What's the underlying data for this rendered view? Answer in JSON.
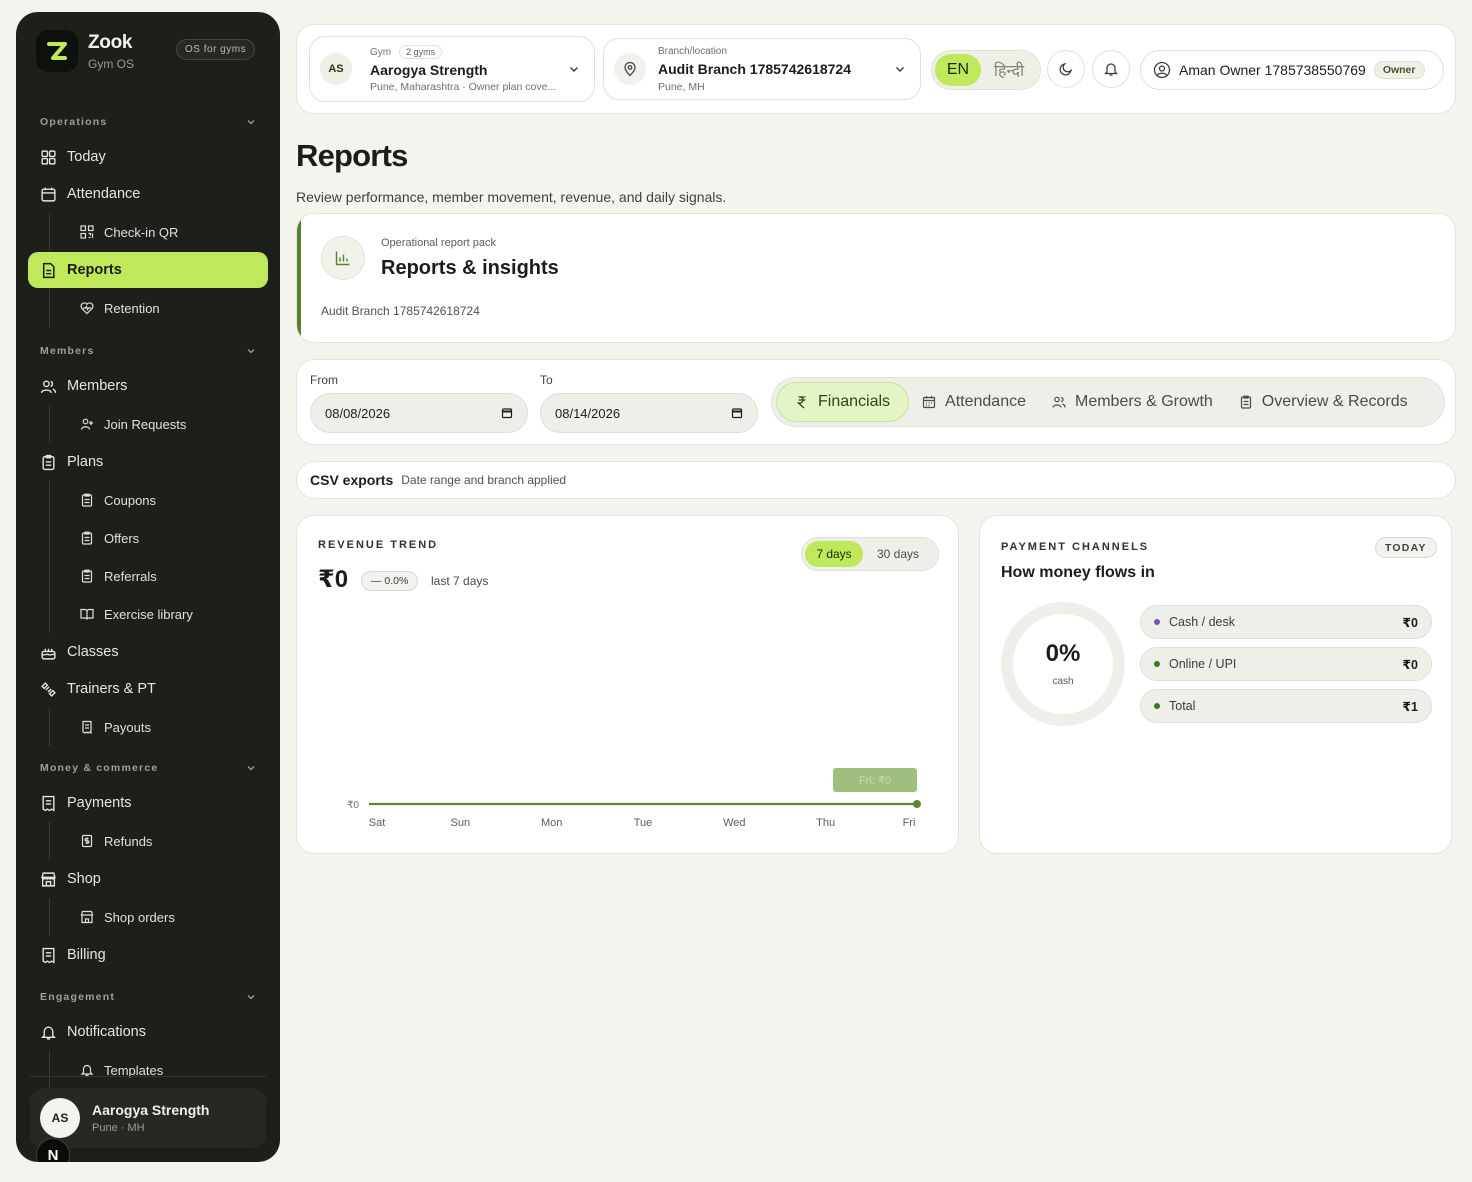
{
  "brand": {
    "name": "Zook",
    "subtitle": "Gym OS",
    "badge": "OS for gyms"
  },
  "sidebar": {
    "sections": {
      "operations": "Operations",
      "members": "Members",
      "money": "Money & commerce",
      "engagement": "Engagement"
    },
    "items": {
      "today": "Today",
      "attendance": "Attendance",
      "checkin_qr": "Check-in QR",
      "reports": "Reports",
      "retention": "Retention",
      "members": "Members",
      "join_requests": "Join Requests",
      "plans": "Plans",
      "coupons": "Coupons",
      "offers": "Offers",
      "referrals": "Referrals",
      "exercise_library": "Exercise library",
      "classes": "Classes",
      "trainers": "Trainers & PT",
      "payouts": "Payouts",
      "payments": "Payments",
      "refunds": "Refunds",
      "shop": "Shop",
      "shop_orders": "Shop orders",
      "billing": "Billing",
      "notifications": "Notifications",
      "templates": "Templates"
    },
    "workspace": {
      "initials": "AS",
      "name": "Aarogya Strength",
      "location": "Pune · MH"
    },
    "n_badge": "N"
  },
  "topbar": {
    "gym": {
      "initials": "AS",
      "label": "Gym",
      "count": "2 gyms",
      "name": "Aarogya Strength",
      "desc": "Pune, Maharashtra · Owner plan cove..."
    },
    "branch": {
      "label": "Branch/location",
      "name": "Audit Branch 1785742618724",
      "city": "Pune, MH"
    },
    "languages": {
      "active": "EN",
      "other": "हिन्दी"
    },
    "user": {
      "name": "Aman Owner 1785738550769",
      "role": "Owner"
    }
  },
  "page": {
    "title": "Reports",
    "subtitle": "Review performance, member movement, revenue, and daily signals."
  },
  "pack": {
    "kicker": "Operational report pack",
    "title": "Reports & insights",
    "branch": "Audit Branch 1785742618724"
  },
  "filters": {
    "from_label": "From",
    "from_value": "08/08/2026",
    "to_label": "To",
    "to_value": "08/14/2026",
    "tabs": [
      "Financials",
      "Attendance",
      "Members & Growth",
      "Overview & Records"
    ],
    "active_tab": "Financials"
  },
  "csv": {
    "title": "CSV exports",
    "note": "Date range and branch applied"
  },
  "revenue": {
    "kicker": "REVENUE TREND",
    "value": "₹0",
    "delta": "— 0.0%",
    "period": "last 7 days",
    "range_options": [
      "7 days",
      "30 days"
    ],
    "active_range": "7 days",
    "tooltip": "Fri: ₹0"
  },
  "payments": {
    "kicker": "PAYMENT CHANNELS",
    "badge": "TODAY",
    "title": "How money flows in",
    "donut_value": "0%",
    "donut_label": "cash",
    "channels": [
      {
        "label": "Cash / desk",
        "amount": "₹0",
        "color": "#7a52b3"
      },
      {
        "label": "Online / UPI",
        "amount": "₹0",
        "color": "#3d7a1e"
      },
      {
        "label": "Total",
        "amount": "₹1",
        "color": "#3d7a1e"
      }
    ]
  },
  "colors": {
    "accent": "#bfe85b",
    "sidebar": "#1d1f1b",
    "line": "#5a8a2e"
  },
  "chart_data": {
    "type": "line",
    "x": [
      "Sat",
      "Sun",
      "Mon",
      "Tue",
      "Wed",
      "Thu",
      "Fri"
    ],
    "series": [
      {
        "values": [
          0,
          0,
          0,
          0,
          0,
          0,
          0
        ]
      }
    ],
    "ytick": "₹0",
    "ylim": [
      0,
      1
    ],
    "grid": false
  }
}
